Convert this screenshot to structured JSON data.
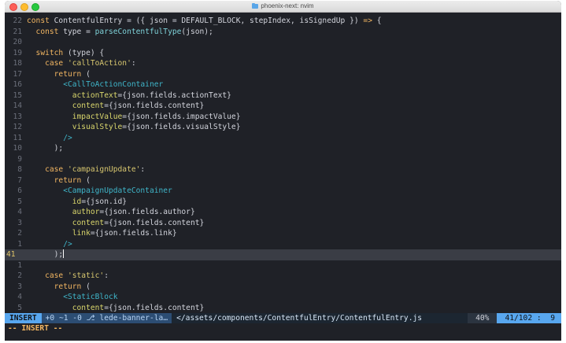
{
  "window": {
    "title": "phoenix-next: nvim",
    "title_icon": "folder-icon"
  },
  "editor": {
    "lines": [
      {
        "num": "22",
        "tokens": [
          {
            "t": "const ",
            "c": "k"
          },
          {
            "t": "ContentfulEntry = ({ json = DEFAULT_BLOCK, stepIndex, isSignedUp }) ",
            "c": ""
          },
          {
            "t": "=>",
            "c": "k"
          },
          {
            "t": " {",
            "c": ""
          }
        ]
      },
      {
        "num": "21",
        "tokens": [
          {
            "t": "  const ",
            "c": "k"
          },
          {
            "t": "type = ",
            "c": ""
          },
          {
            "t": "parseContentfulType",
            "c": "cyan"
          },
          {
            "t": "(json);",
            "c": ""
          }
        ]
      },
      {
        "num": "20",
        "tokens": []
      },
      {
        "num": "19",
        "tokens": [
          {
            "t": "  switch ",
            "c": "k"
          },
          {
            "t": "(type) {",
            "c": ""
          }
        ]
      },
      {
        "num": "18",
        "tokens": [
          {
            "t": "    case ",
            "c": "k"
          },
          {
            "t": "'callToAction'",
            "c": "str"
          },
          {
            "t": ":",
            "c": ""
          }
        ]
      },
      {
        "num": "17",
        "tokens": [
          {
            "t": "      return ",
            "c": "k"
          },
          {
            "t": "(",
            "c": ""
          }
        ]
      },
      {
        "num": "16",
        "tokens": [
          {
            "t": "        <CallToActionContainer",
            "c": "tag"
          }
        ]
      },
      {
        "num": "15",
        "tokens": [
          {
            "t": "          actionText",
            "c": "attr"
          },
          {
            "t": "={json.fields.actionText}",
            "c": ""
          }
        ]
      },
      {
        "num": "14",
        "tokens": [
          {
            "t": "          content",
            "c": "attr"
          },
          {
            "t": "={json.fields.content}",
            "c": ""
          }
        ]
      },
      {
        "num": "13",
        "tokens": [
          {
            "t": "          impactValue",
            "c": "attr"
          },
          {
            "t": "={json.fields.impactValue}",
            "c": ""
          }
        ]
      },
      {
        "num": "12",
        "tokens": [
          {
            "t": "          visualStyle",
            "c": "attr"
          },
          {
            "t": "={json.fields.visualStyle}",
            "c": ""
          }
        ]
      },
      {
        "num": "11",
        "tokens": [
          {
            "t": "        />",
            "c": "tag"
          }
        ]
      },
      {
        "num": "10",
        "tokens": [
          {
            "t": "      );",
            "c": ""
          }
        ]
      },
      {
        "num": "9",
        "tokens": []
      },
      {
        "num": "8",
        "tokens": [
          {
            "t": "    case ",
            "c": "k"
          },
          {
            "t": "'campaignUpdate'",
            "c": "str"
          },
          {
            "t": ":",
            "c": ""
          }
        ]
      },
      {
        "num": "7",
        "tokens": [
          {
            "t": "      return ",
            "c": "k"
          },
          {
            "t": "(",
            "c": ""
          }
        ]
      },
      {
        "num": "6",
        "tokens": [
          {
            "t": "        <CampaignUpdateContainer",
            "c": "tag"
          }
        ]
      },
      {
        "num": "5",
        "tokens": [
          {
            "t": "          id",
            "c": "attr"
          },
          {
            "t": "={json.id}",
            "c": ""
          }
        ]
      },
      {
        "num": "4",
        "tokens": [
          {
            "t": "          author",
            "c": "attr"
          },
          {
            "t": "={json.fields.author}",
            "c": ""
          }
        ]
      },
      {
        "num": "3",
        "tokens": [
          {
            "t": "          content",
            "c": "attr"
          },
          {
            "t": "={json.fields.content}",
            "c": ""
          }
        ]
      },
      {
        "num": "2",
        "tokens": [
          {
            "t": "          link",
            "c": "attr"
          },
          {
            "t": "={json.fields.link}",
            "c": ""
          }
        ]
      },
      {
        "num": "1",
        "tokens": [
          {
            "t": "        />",
            "c": "tag"
          }
        ]
      },
      {
        "num": "41",
        "current": true,
        "tokens": [
          {
            "t": "      );",
            "c": ""
          }
        ]
      },
      {
        "num": "1",
        "tokens": []
      },
      {
        "num": "2",
        "tokens": [
          {
            "t": "    case ",
            "c": "k"
          },
          {
            "t": "'static'",
            "c": "str"
          },
          {
            "t": ":",
            "c": ""
          }
        ]
      },
      {
        "num": "3",
        "tokens": [
          {
            "t": "      return ",
            "c": "k"
          },
          {
            "t": "(",
            "c": ""
          }
        ]
      },
      {
        "num": "4",
        "tokens": [
          {
            "t": "        <StaticBlock",
            "c": "tag"
          }
        ]
      },
      {
        "num": "5",
        "tokens": [
          {
            "t": "          content",
            "c": "attr"
          },
          {
            "t": "={json.fields.content}",
            "c": ""
          }
        ]
      }
    ]
  },
  "statusline": {
    "mode": "INSERT",
    "git": "+0 ~1 -0 ⎇ lede-banner-la…",
    "filepath": "</assets/components/ContentfulEntry/ContentfulEntry.js",
    "percent": "40%",
    "position": "41/102 :  9"
  },
  "cmdline": "-- INSERT --",
  "colors": {
    "background": "#1f2127",
    "keyword": "#f2b662",
    "jsx_tag": "#3fb5c9",
    "jsx_attr": "#d9d66c",
    "string": "#d8c76f",
    "mode_badge": "#58a7ef"
  }
}
